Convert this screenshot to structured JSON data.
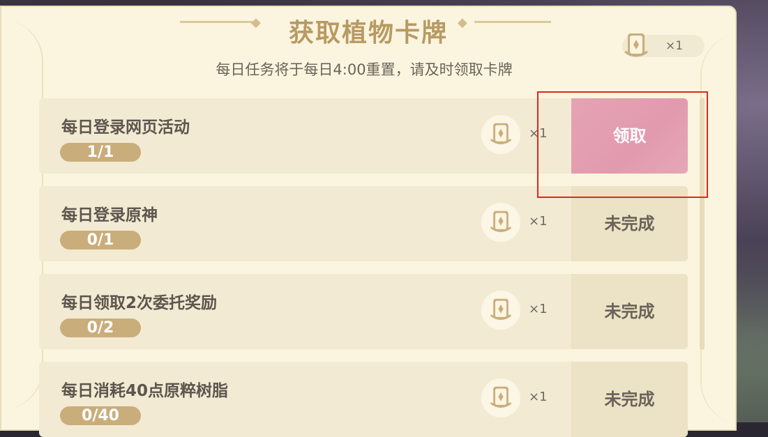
{
  "header": {
    "title": "获取植物卡牌",
    "subtitle": "每日任务将于每日4:00重置，请及时领取卡牌",
    "token_count": "×1"
  },
  "tasks": [
    {
      "name": "每日登录网页活动",
      "progress": "1/1",
      "reward": "×1",
      "action": "领取",
      "state": "claimable"
    },
    {
      "name": "每日登录原神",
      "progress": "0/1",
      "reward": "×1",
      "action": "未完成",
      "state": "incomplete"
    },
    {
      "name": "每日领取2次委托奖励",
      "progress": "0/2",
      "reward": "×1",
      "action": "未完成",
      "state": "incomplete"
    },
    {
      "name": "每日消耗40点原粹树脂",
      "progress": "0/40",
      "reward": "×1",
      "action": "未完成",
      "state": "incomplete"
    }
  ],
  "icons": {
    "card": "plant-card-icon",
    "diamond": "diamond-ornament-icon"
  },
  "colors": {
    "panel_bg": "#fbf5e0",
    "title": "#b89a63",
    "progress_pill": "#c9ad7b",
    "claim_button": "#e29aae",
    "incomplete_button": "#ece2c5",
    "highlight": "#e1261c"
  }
}
